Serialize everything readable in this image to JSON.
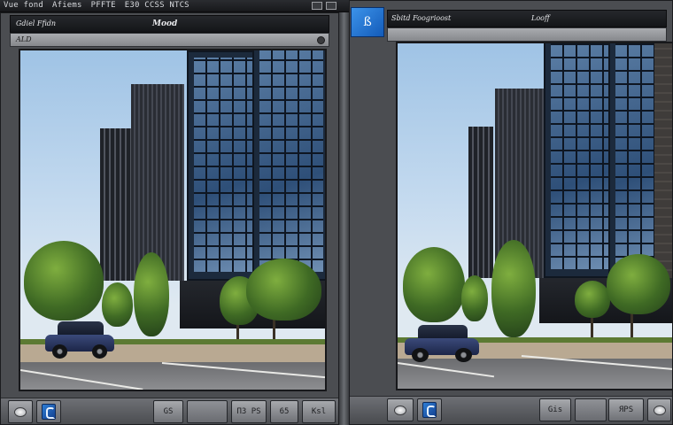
{
  "menu_bar": {
    "items": [
      "Vue fond",
      "Afiems",
      "PFFTE",
      "E30 CCSS NTCS"
    ]
  },
  "left_window": {
    "title": "Mood",
    "subtitle": "Gdiel Ffidn",
    "tab_label": "ALD",
    "toolbar": {
      "buttons": [
        "",
        "",
        "GS",
        "",
        "ПЗ PS",
        "65",
        "Кsl"
      ]
    }
  },
  "right_window": {
    "app_badge": "ß",
    "title_left": "Sbitd Foogrioost",
    "title_right": "Looff",
    "toolbar": {
      "buttons": [
        "",
        "",
        "",
        "Gis",
        "",
        "ЯPS",
        ""
      ]
    }
  },
  "icons": {
    "app": "app-logo-icon",
    "round": "round-button-icon",
    "blue": "app-shortcut-icon"
  },
  "colors": {
    "accent": "#1f6fd0",
    "chrome": "#4b4d51",
    "titlebar": "#17181b"
  }
}
